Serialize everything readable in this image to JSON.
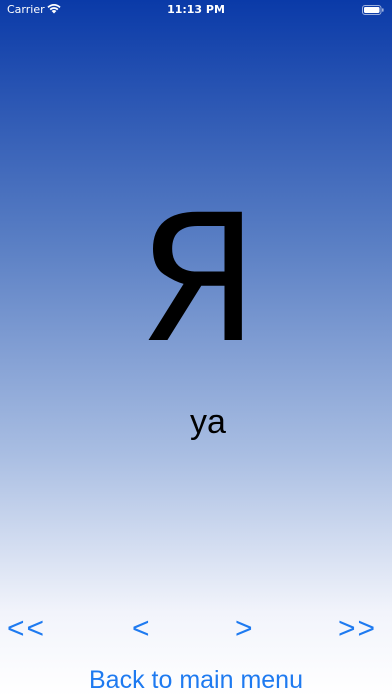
{
  "status_bar": {
    "carrier": "Carrier",
    "time": "11:13 PM",
    "icons": [
      "wifi-icon",
      "battery-icon"
    ]
  },
  "card": {
    "letter": "Я",
    "transliteration": "ya"
  },
  "navigation": {
    "first_label": "<<",
    "previous_label": "<",
    "next_label": ">",
    "last_label": ">>"
  },
  "back_button_label": "Back to main menu",
  "colors": {
    "gradient_top": "#0a3aa8",
    "gradient_bottom": "#ffffff",
    "link_blue": "#1e7af0",
    "text": "#000000"
  }
}
